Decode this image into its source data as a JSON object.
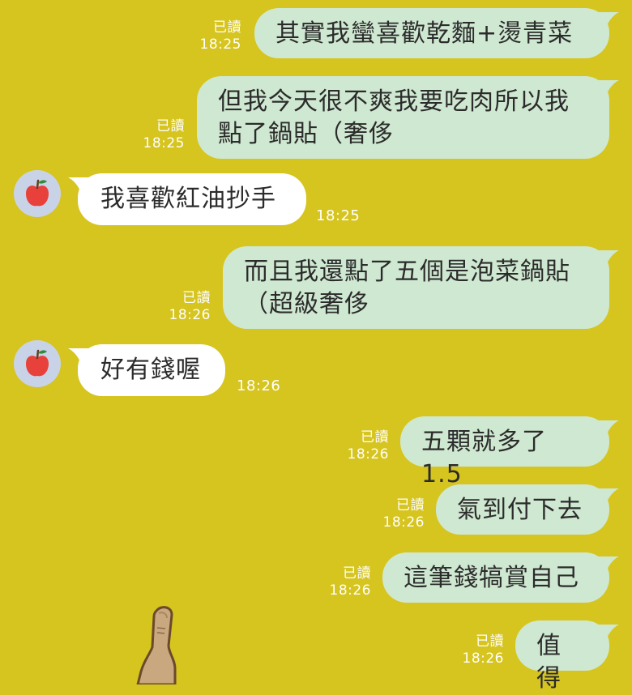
{
  "colors": {
    "background": "#d6c41f",
    "sent_bubble": "#cfe8d1",
    "received_bubble": "#ffffff",
    "meta_text": "#ffffff",
    "avatar_bg": "#c9d3e7",
    "apple_red": "#e8403a"
  },
  "messages": [
    {
      "side": "sent",
      "read_label": "已讀",
      "time": "18:25",
      "lines": [
        "其實我蠻喜歡乾麵+燙青菜"
      ]
    },
    {
      "side": "sent",
      "read_label": "已讀",
      "time": "18:25",
      "lines": [
        "但我今天很不爽我要吃肉所以我",
        "點了鍋貼（奢侈"
      ]
    },
    {
      "side": "received",
      "avatar_icon": "apple-icon",
      "time": "18:25",
      "lines": [
        "我喜歡紅油抄手"
      ]
    },
    {
      "side": "sent",
      "read_label": "已讀",
      "time": "18:26",
      "lines": [
        "而且我還點了五個是泡菜鍋貼",
        "（超級奢侈"
      ]
    },
    {
      "side": "received",
      "avatar_icon": "apple-icon",
      "time": "18:26",
      "lines": [
        "好有錢喔"
      ]
    },
    {
      "side": "sent",
      "read_label": "已讀",
      "time": "18:26",
      "lines": [
        "五顆就多了1.5"
      ]
    },
    {
      "side": "sent",
      "read_label": "已讀",
      "time": "18:26",
      "lines": [
        "氣到付下去"
      ]
    },
    {
      "side": "sent",
      "read_label": "已讀",
      "time": "18:26",
      "lines": [
        "這筆錢犒賞自己"
      ]
    },
    {
      "side": "sent",
      "read_label": "已讀",
      "time": "18:26",
      "lines": [
        "值得"
      ]
    }
  ],
  "decoration_icon": "pointing-finger-sticker-icon"
}
